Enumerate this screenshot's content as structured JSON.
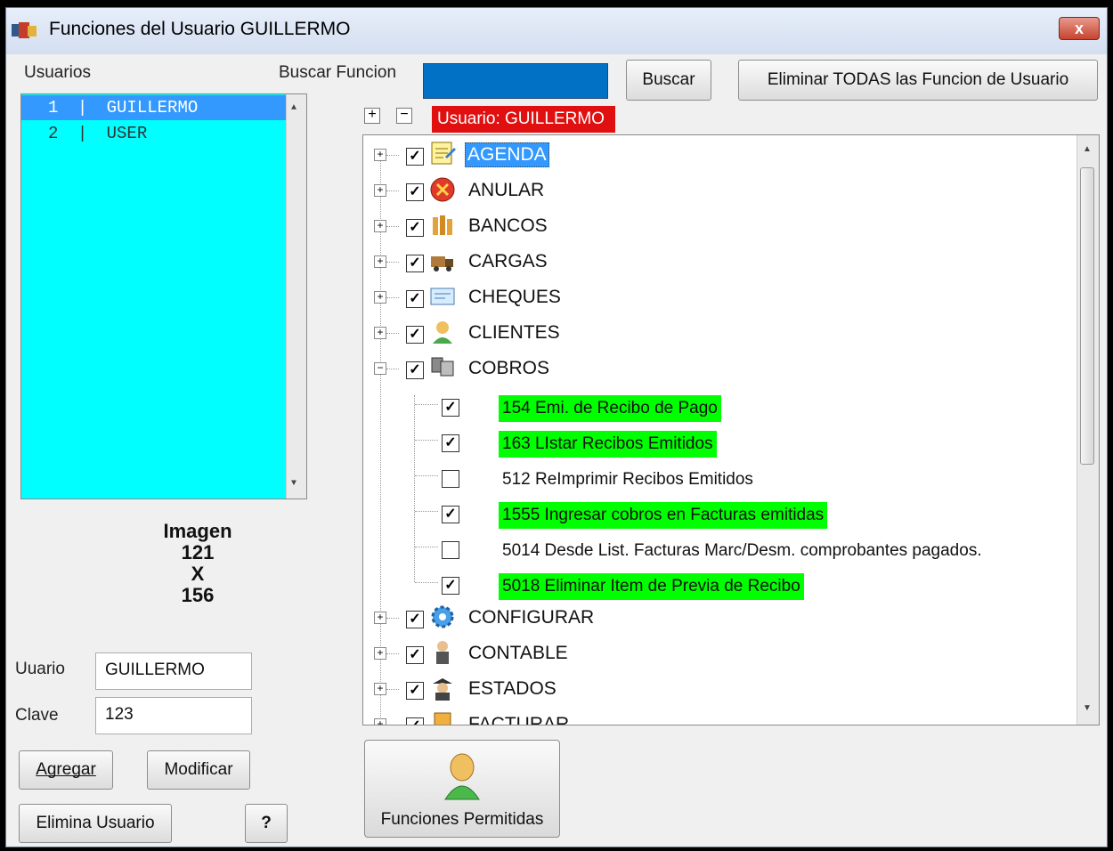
{
  "window": {
    "title": "Funciones del Usuario GUILLERMO",
    "close_label": "x"
  },
  "left": {
    "users_label": "Usuarios",
    "users": [
      {
        "id": "1",
        "name": "GUILLERMO",
        "selected": true
      },
      {
        "id": "2",
        "name": "USER",
        "selected": false
      }
    ],
    "image": {
      "label": "Imagen",
      "width": "121",
      "x": "X",
      "height": "156"
    },
    "usuario_label": "Uuario",
    "usuario_value": "GUILLERMO",
    "clave_label": "Clave",
    "clave_value": "123",
    "buttons": {
      "agregar": "Agregar",
      "modificar": "Modificar",
      "elimina": "Elimina Usuario",
      "help": "?"
    }
  },
  "top": {
    "search_label": "Buscar Funcion",
    "search_value": "",
    "search_button": "Buscar",
    "delete_all_button": "Eliminar TODAS las Funcion de Usuario",
    "expand_all": "+",
    "collapse_all": "−",
    "user_badge": "Usuario: GUILLERMO"
  },
  "tree": {
    "nodes": [
      {
        "label": "AGENDA",
        "checked": true,
        "expanded": false,
        "icon": "agenda-icon",
        "selected": true
      },
      {
        "label": "ANULAR",
        "checked": true,
        "expanded": false,
        "icon": "cancel-icon"
      },
      {
        "label": "BANCOS",
        "checked": true,
        "expanded": false,
        "icon": "bank-icon"
      },
      {
        "label": "CARGAS",
        "checked": true,
        "expanded": false,
        "icon": "truck-icon"
      },
      {
        "label": "CHEQUES",
        "checked": true,
        "expanded": false,
        "icon": "cheque-icon"
      },
      {
        "label": "CLIENTES",
        "checked": true,
        "expanded": false,
        "icon": "clients-icon"
      },
      {
        "label": "COBROS",
        "checked": true,
        "expanded": true,
        "icon": "cobros-icon",
        "children": [
          {
            "label": "154 Emi. de Recibo de Pago",
            "checked": true
          },
          {
            "label": "163 LIstar Recibos Emitidos",
            "checked": true
          },
          {
            "label": "512 ReImprimir Recibos Emitidos",
            "checked": false
          },
          {
            "label": "1555 Ingresar cobros en Facturas emitidas",
            "checked": true
          },
          {
            "label": "5014 Desde List. Facturas Marc/Desm. comprobantes pagados.",
            "checked": false
          },
          {
            "label": "5018 Eliminar Item de Previa de Recibo",
            "checked": true
          }
        ]
      },
      {
        "label": "CONFIGURAR",
        "checked": true,
        "expanded": false,
        "icon": "gear-icon"
      },
      {
        "label": "CONTABLE",
        "checked": true,
        "expanded": false,
        "icon": "accountant-icon"
      },
      {
        "label": "ESTADOS",
        "checked": true,
        "expanded": false,
        "icon": "spy-icon"
      },
      {
        "label": "FACTURAR",
        "checked": true,
        "expanded": false,
        "icon": "invoice-icon"
      }
    ]
  },
  "bottom": {
    "permitted_button": "Funciones Permitidas"
  },
  "colors": {
    "list_bg": "#00ffff",
    "selected": "#3399ff",
    "granted": "#00ff00",
    "badge": "#e01010",
    "search_bg": "#0071c5"
  }
}
